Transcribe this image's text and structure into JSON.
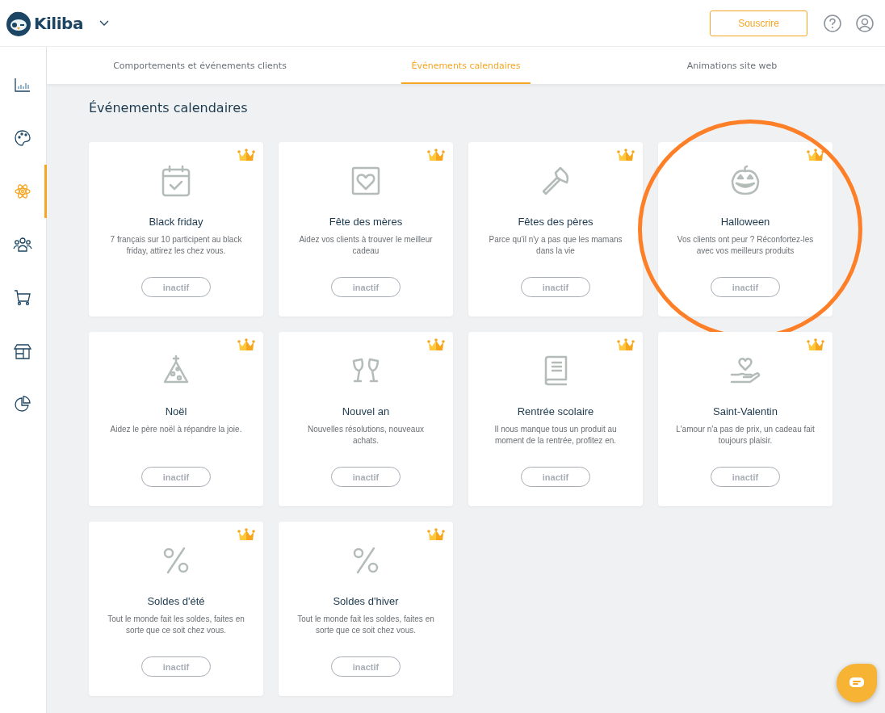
{
  "header": {
    "logo": "Kiliba",
    "subscribe_button": "Souscrire"
  },
  "sidebar": {
    "items": [
      {
        "kind": "chart",
        "selected": false
      },
      {
        "kind": "palette",
        "selected": false
      },
      {
        "kind": "atom",
        "selected": true
      },
      {
        "kind": "people",
        "selected": false
      },
      {
        "kind": "cart",
        "selected": false
      },
      {
        "kind": "store",
        "selected": false
      },
      {
        "kind": "pie",
        "selected": false
      }
    ]
  },
  "tabs": [
    {
      "label": "Comportements et événements clients",
      "selected": false
    },
    {
      "label": "Événements calendaires",
      "selected": true
    },
    {
      "label": "Animations site web",
      "selected": false
    }
  ],
  "page_title": "Événements calendaires",
  "cards": [
    {
      "kind": "calendar",
      "title": "Black friday",
      "description": "7 français sur 10 participent au black friday, attirez les chez vous.",
      "status": "inactif",
      "premium": true,
      "circled": false
    },
    {
      "kind": "heart",
      "title": "Fête des mères",
      "description": "Aidez vos clients à trouver le meilleur cadeau",
      "status": "inactif",
      "premium": true,
      "circled": false
    },
    {
      "kind": "axe",
      "title": "Fêtes des pères",
      "description": "Parce qu'il n'y a pas que les mamans dans la vie",
      "status": "inactif",
      "premium": true,
      "circled": false
    },
    {
      "kind": "pumpkin",
      "title": "Halloween",
      "description": "Vos clients ont peur ? Réconfortez-les avec vos meilleurs produits",
      "status": "inactif",
      "premium": true,
      "circled": true
    },
    {
      "kind": "tree",
      "title": "Noël",
      "description": "Aidez le père noël à répandre la joie.",
      "status": "inactif",
      "premium": true,
      "circled": false
    },
    {
      "kind": "glasses",
      "title": "Nouvel an",
      "description": "Nouvelles résolutions, nouveaux achats.",
      "status": "inactif",
      "premium": true,
      "circled": false
    },
    {
      "kind": "book",
      "title": "Rentrée scolaire",
      "description": "Il nous manque tous un produit au moment de la rentrée, profitez en.",
      "status": "inactif",
      "premium": true,
      "circled": false
    },
    {
      "kind": "hand-heart",
      "title": "Saint-Valentin",
      "description": "L'amour n'a pas de prix, un cadeau fait toujours plaisir.",
      "status": "inactif",
      "premium": true,
      "circled": false
    },
    {
      "kind": "percent",
      "title": "Soldes d'été",
      "description": "Tout le monde fait les soldes, faites en sorte que ce soit chez vous.",
      "status": "inactif",
      "premium": true,
      "circled": false
    },
    {
      "kind": "percent",
      "title": "Soldes d'hiver",
      "description": "Tout le monde fait les soldes, faites en sorte que ce soit chez vous.",
      "status": "inactif",
      "premium": true,
      "circled": false
    }
  ]
}
